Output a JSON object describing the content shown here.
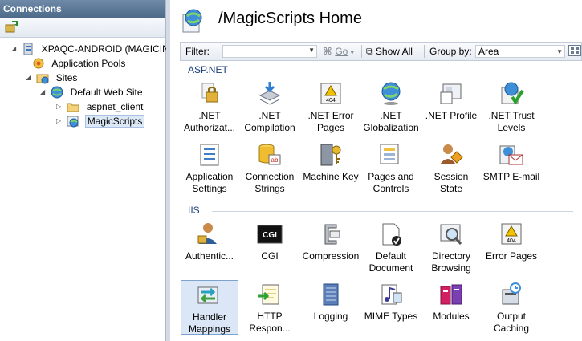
{
  "connections": {
    "header": "Connections",
    "tree": [
      {
        "label": "XPAQC-ANDROID (MAGICINI",
        "icon": "server-icon"
      },
      {
        "label": "Application Pools",
        "icon": "app-pools-icon"
      },
      {
        "label": "Sites",
        "icon": "sites-folder-icon"
      },
      {
        "label": "Default Web Site",
        "icon": "globe-icon"
      },
      {
        "label": "aspnet_client",
        "icon": "folder-icon"
      },
      {
        "label": "MagicScripts",
        "icon": "web-app-icon"
      }
    ]
  },
  "header": {
    "title": "/MagicScripts Home"
  },
  "filterbar": {
    "filter_label": "Filter:",
    "go_label": "Go",
    "showall_label": "Show All",
    "groupby_label": "Group by:",
    "groupby_value": "Area"
  },
  "groups": [
    {
      "name": "ASP.NET",
      "features": [
        {
          "label": ".NET Authorizat...",
          "icon": "lock-icon"
        },
        {
          "label": ".NET Compilation",
          "icon": "stack-arrow-icon"
        },
        {
          "label": ".NET Error Pages",
          "icon": "error-404-icon"
        },
        {
          "label": ".NET Globalization",
          "icon": "globe-icon"
        },
        {
          "label": ".NET Profile",
          "icon": "profile-icon"
        },
        {
          "label": ".NET Trust Levels",
          "icon": "trust-icon"
        },
        {
          "label": "Application Settings",
          "icon": "settings-list-icon"
        },
        {
          "label": "Connection Strings",
          "icon": "database-icon"
        },
        {
          "label": "Machine Key",
          "icon": "key-icon"
        },
        {
          "label": "Pages and Controls",
          "icon": "pages-icon"
        },
        {
          "label": "Session State",
          "icon": "user-diamond-icon"
        },
        {
          "label": "SMTP E-mail",
          "icon": "email-icon"
        }
      ]
    },
    {
      "name": "IIS",
      "features": [
        {
          "label": "Authentic...",
          "icon": "user-lock-icon"
        },
        {
          "label": "CGI",
          "icon": "cgi-icon"
        },
        {
          "label": "Compression",
          "icon": "clamp-icon"
        },
        {
          "label": "Default Document",
          "icon": "document-check-icon"
        },
        {
          "label": "Directory Browsing",
          "icon": "magnifier-icon"
        },
        {
          "label": "Error Pages",
          "icon": "error-404-icon"
        },
        {
          "label": "Handler Mappings",
          "icon": "handler-icon"
        },
        {
          "label": "HTTP Respon...",
          "icon": "http-response-icon"
        },
        {
          "label": "Logging",
          "icon": "notebook-icon"
        },
        {
          "label": "MIME Types",
          "icon": "mime-icon"
        },
        {
          "label": "Modules",
          "icon": "modules-icon"
        },
        {
          "label": "Output Caching",
          "icon": "caching-icon"
        }
      ]
    }
  ],
  "colors": {
    "accent": "#1a3f7a",
    "header": "#4d6a8a",
    "selection": "#dbe7f7"
  }
}
